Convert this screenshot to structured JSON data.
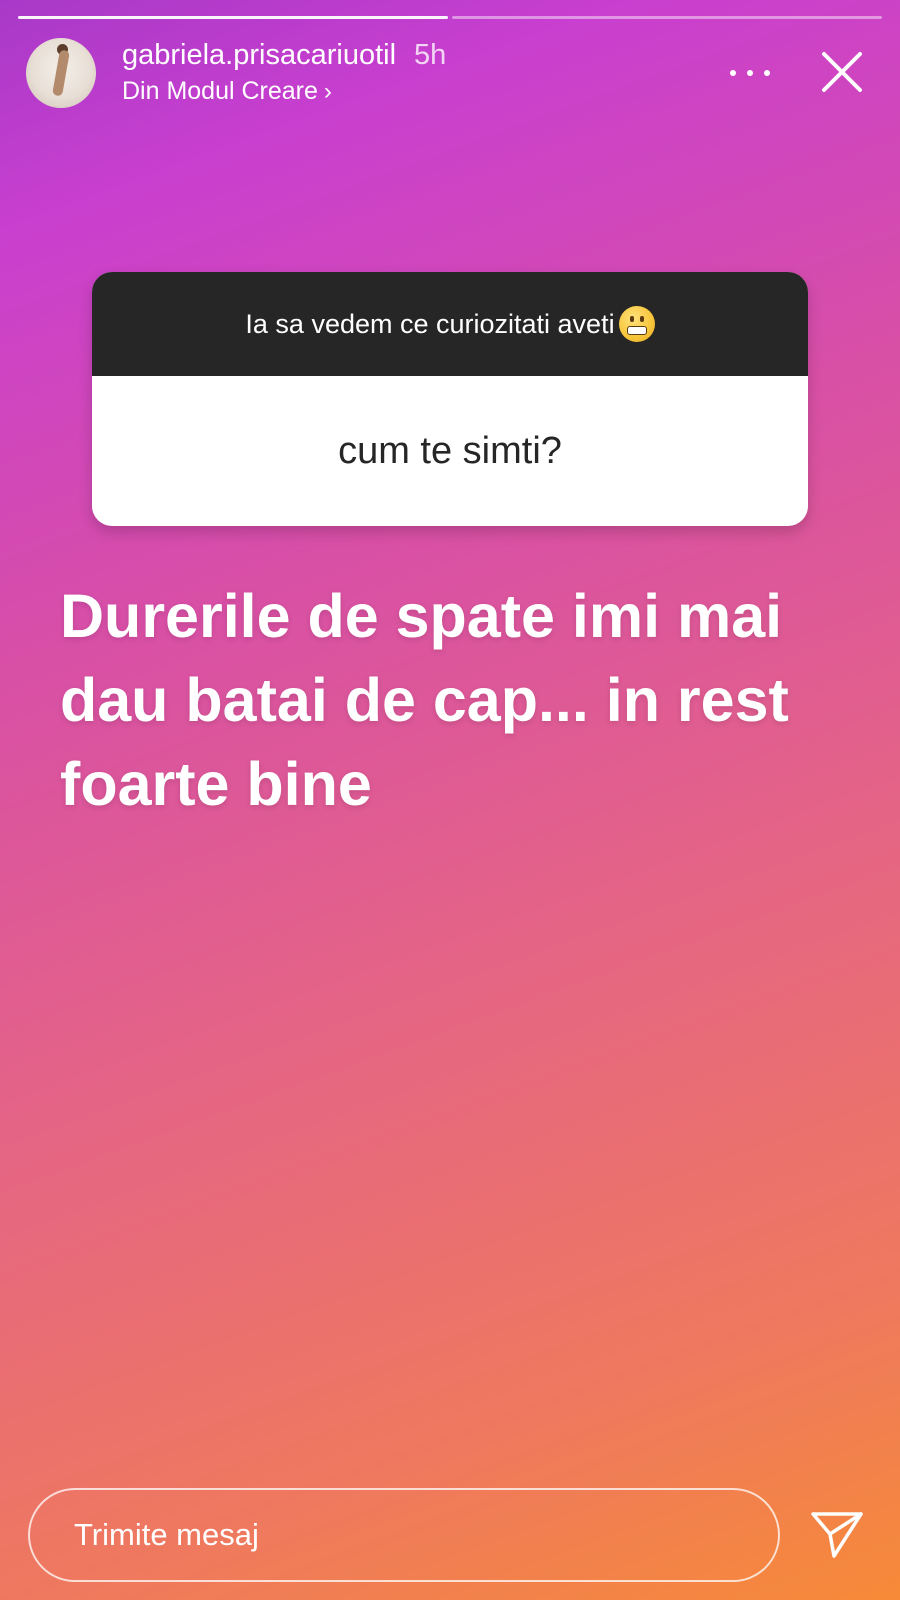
{
  "story": {
    "segments_total": 2,
    "segments_done": 1
  },
  "header": {
    "username": "gabriela.prisacariuotil",
    "time": "5h",
    "subtitle": "Din Modul Creare",
    "subtitle_chevron": "›",
    "avatar_icon": "profile-photo",
    "more_icon": "more-horizontal-icon",
    "close_icon": "close-icon"
  },
  "question_sticker": {
    "prompt": "Ia sa vedem ce curiozitati aveti",
    "emoji_icon": "grimacing-face-emoji",
    "answer": "cum te simti?"
  },
  "reply_text": "Durerile de spate imi mai dau batai de cap... in rest foarte bine",
  "footer": {
    "message_placeholder": "Trimite mesaj",
    "send_icon": "send-paper-plane-icon"
  },
  "colors": {
    "gradient_top": "#c93fcf",
    "gradient_bottom": "#f68a38",
    "sticker_header": "#262626",
    "sticker_body": "#ffffff"
  }
}
